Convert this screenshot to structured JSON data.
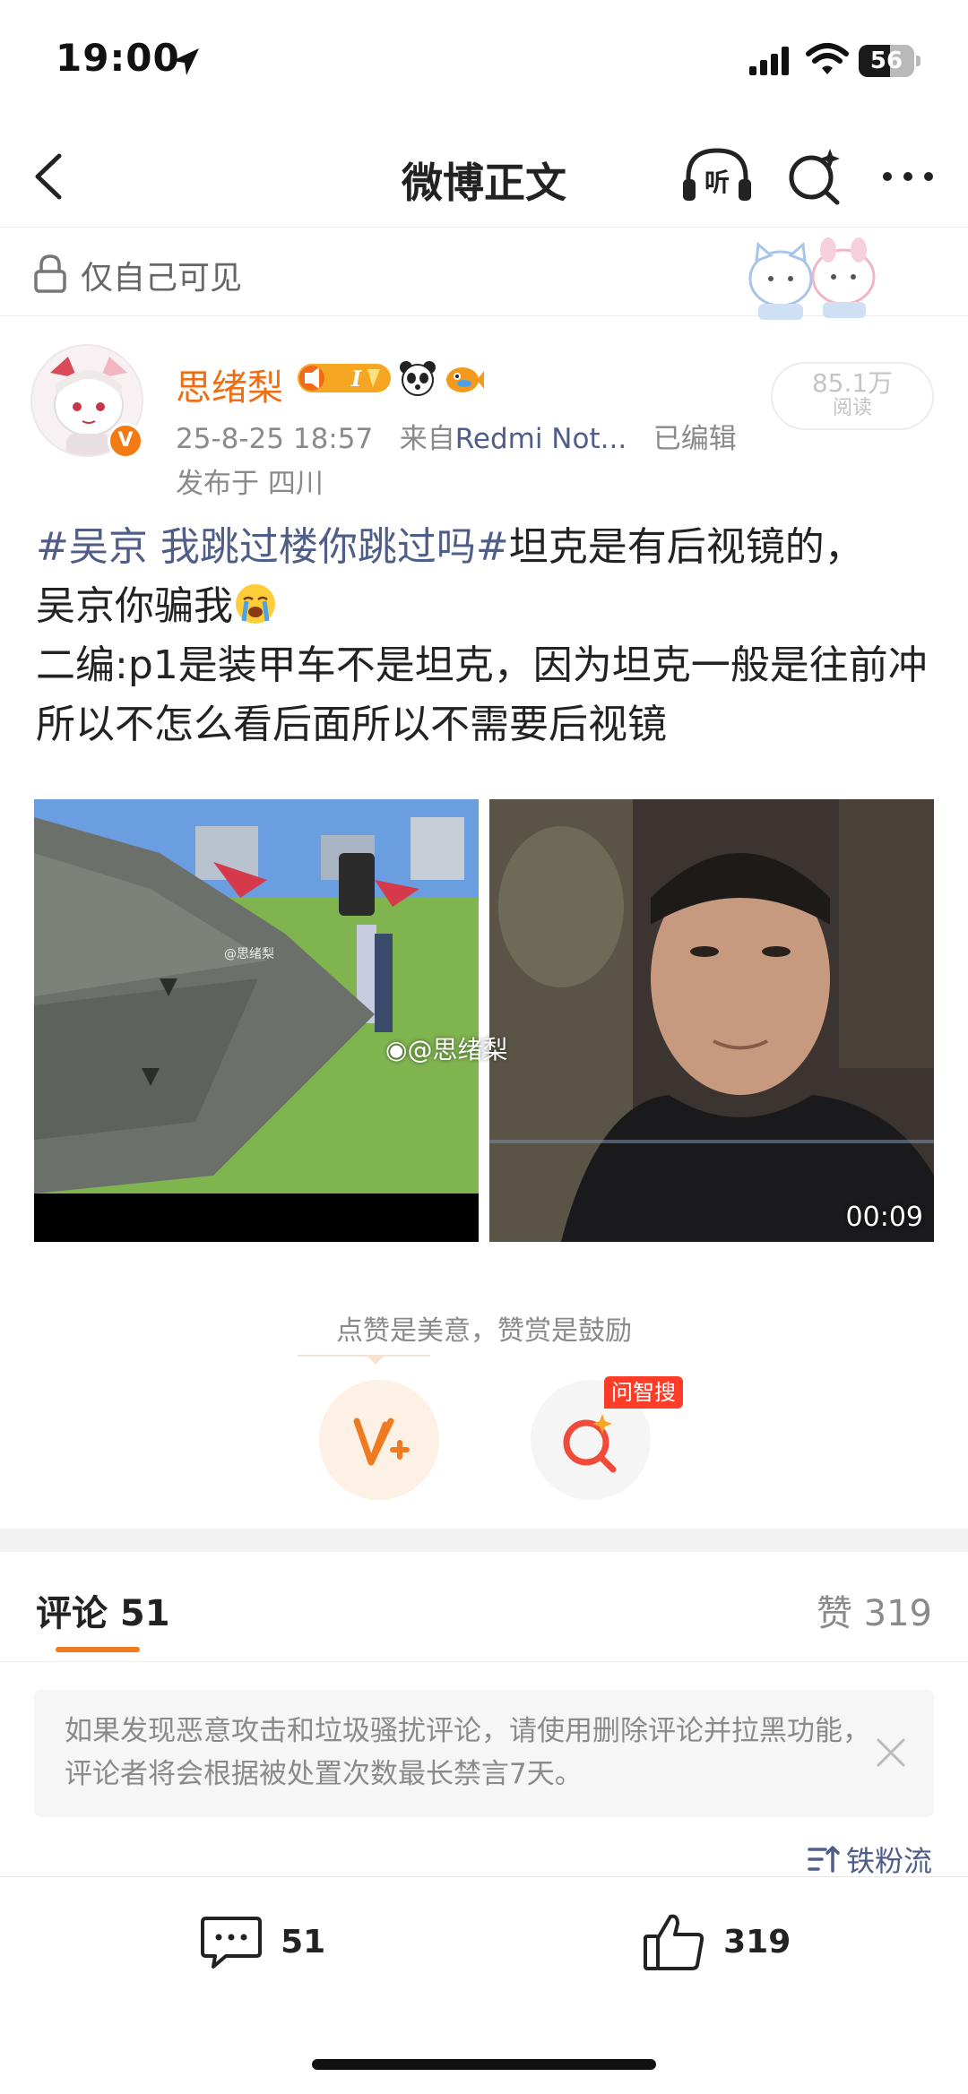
{
  "status_bar": {
    "time": "19:00",
    "battery": "56",
    "battery_level": 0.56
  },
  "nav": {
    "title": "微博正文",
    "listen_label": "听"
  },
  "visibility": {
    "label": "仅自己可见"
  },
  "author": {
    "name": "思绪梨",
    "verified_badge": "V",
    "badge_icons": [
      "speaker-badge-icon",
      "i-level-badge-icon",
      "panda-icon",
      "fish-icon"
    ]
  },
  "post": {
    "meta_time": "25-8-25 18:57",
    "meta_from": "来自",
    "meta_device": "Redmi Not...",
    "meta_edited": "已编辑",
    "location": "发布于 四川",
    "reads_count": "85.1万",
    "reads_label": "阅读",
    "hashtag": "#吴京 我跳过楼你跳过吗#",
    "text_line1": "坦克是有后视镜的，",
    "text_line2": "吴京你骗我",
    "text_edit": "二编:p1是装甲车不是坦克，因为坦克一般是往前冲所以不怎么看后面所以不需要后视镜",
    "watermark_small": "@思绪梨",
    "watermark_large": "@思绪梨",
    "video_duration": "00:09"
  },
  "reward": {
    "caption": "点赞是美意，赞赏是鼓励",
    "ask_label": "问智搜"
  },
  "comments": {
    "label": "评论 51",
    "likes_label": "赞 319",
    "notice": "如果发现恶意攻击和垃圾骚扰评论，请使用删除评论并拉黑功能，评论者将会根据被处置次数最长禁言7天。",
    "sort_label": "铁粉流"
  },
  "bottom_bar": {
    "comment_count": "51",
    "like_count": "319"
  },
  "colors": {
    "accent": "#ee6e16",
    "link": "#4f5d88",
    "underline": "#f07a20",
    "badge_red": "#ff3c28"
  }
}
